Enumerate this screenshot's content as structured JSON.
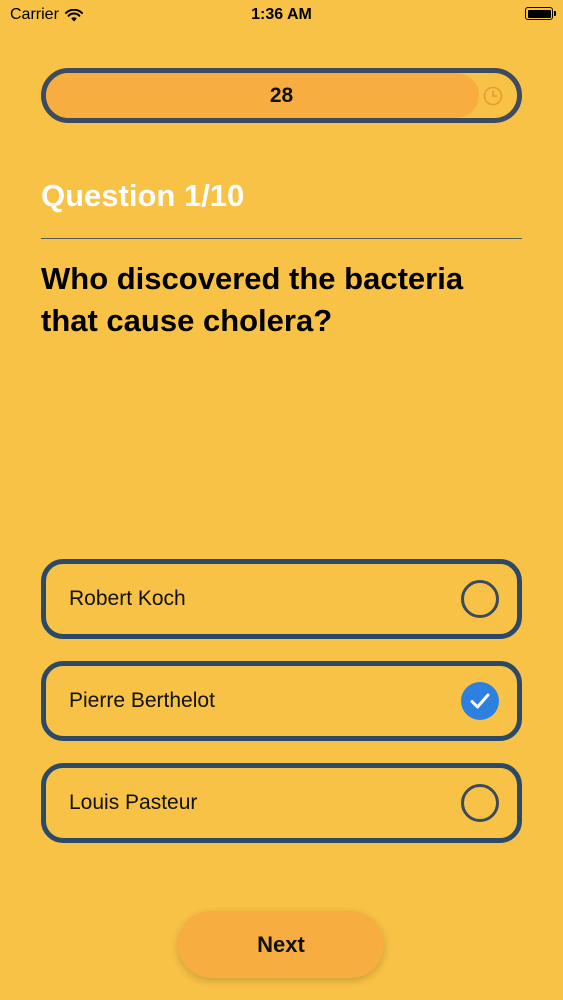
{
  "status_bar": {
    "carrier": "Carrier",
    "time": "1:36 AM"
  },
  "timer": {
    "value": "28",
    "fraction_remaining": 0.92
  },
  "question": {
    "counter": "Question 1/10",
    "text": "Who discovered the bacteria that cause cholera?"
  },
  "options": [
    {
      "label": "Robert Koch",
      "selected": false
    },
    {
      "label": "Pierre Berthelot",
      "selected": true
    },
    {
      "label": "Louis Pasteur",
      "selected": false
    }
  ],
  "next_label": "Next",
  "colors": {
    "background": "#F8C246",
    "timer_fill": "#F7AD3F",
    "border": "#2B4A68",
    "selected": "#2D7FE0",
    "counter_text": "#FFFFFF"
  }
}
